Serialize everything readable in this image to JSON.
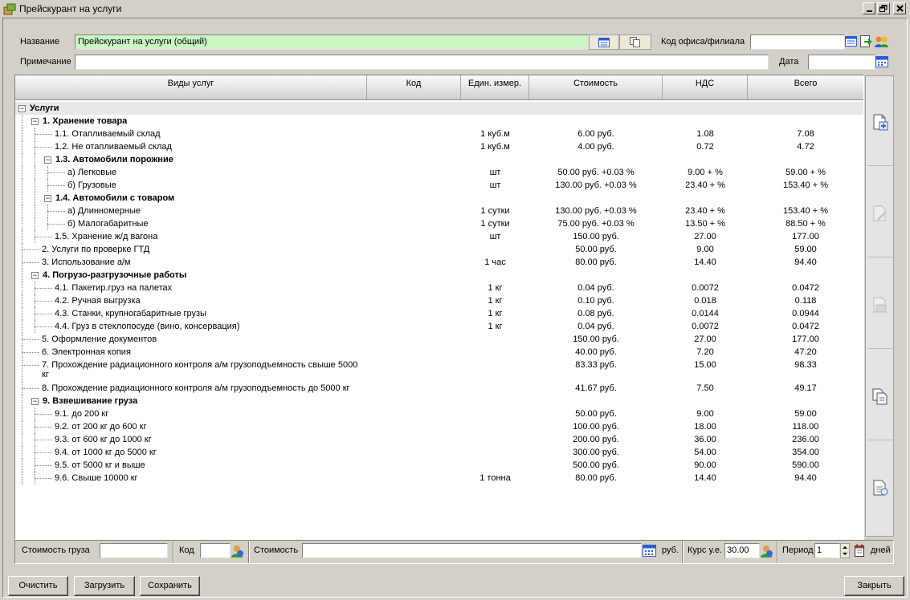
{
  "window": {
    "title": "Прейскурант на услуги"
  },
  "form": {
    "name_label": "Название",
    "name_value": "Прейскурант на услуги (общий)",
    "office_label": "Код офиса/филиала",
    "office_value": "",
    "note_label": "Примечание",
    "note_value": "",
    "date_label": "Дата",
    "date_value": ""
  },
  "table": {
    "columns": [
      "Виды услуг",
      "Код",
      "Един. измер.",
      "Стоимость",
      "НДС",
      "Всего"
    ],
    "rows": [
      {
        "name": "Услуги",
        "unit": "",
        "cost": "",
        "vat": "",
        "total": "",
        "level": 0,
        "bold": true,
        "expander": true,
        "selected": true
      },
      {
        "name": "1. Хранение товара",
        "unit": "",
        "cost": "",
        "vat": "",
        "total": "",
        "level": 1,
        "bold": true,
        "expander": true
      },
      {
        "name": "1.1. Отапливаемый склад",
        "unit": "1 куб.м",
        "cost": "6.00 руб.",
        "vat": "1.08",
        "total": "7.08",
        "level": 2
      },
      {
        "name": "1.2. Не отапливаемый склад",
        "unit": "1 куб.м",
        "cost": "4.00 руб.",
        "vat": "0.72",
        "total": "4.72",
        "level": 2
      },
      {
        "name": "1.3. Автомобили порожние",
        "unit": "",
        "cost": "",
        "vat": "",
        "total": "",
        "level": 2,
        "bold": true,
        "expander": true
      },
      {
        "name": "а) Легковые",
        "unit": "шт",
        "cost": "50.00 руб. +0.03 %",
        "vat": "9.00 + %",
        "total": "59.00 + %",
        "level": 3
      },
      {
        "name": "б) Грузовые",
        "unit": "шт",
        "cost": "130.00 руб. +0.03 %",
        "vat": "23.40 + %",
        "total": "153.40 + %",
        "level": 3
      },
      {
        "name": "1.4. Автомобили с товаром",
        "unit": "",
        "cost": "",
        "vat": "",
        "total": "",
        "level": 2,
        "bold": true,
        "expander": true
      },
      {
        "name": "а) Длинномерные",
        "unit": "1 сутки",
        "cost": "130.00 руб. +0.03 %",
        "vat": "23.40 + %",
        "total": "153.40 + %",
        "level": 3
      },
      {
        "name": "б) Малогабаритные",
        "unit": "1 сутки",
        "cost": "75.00 руб. +0.03 %",
        "vat": "13.50 + %",
        "total": "88.50 + %",
        "level": 3
      },
      {
        "name": "1.5. Хранение ж/д вагона",
        "unit": "шт",
        "cost": "150.00 руб.",
        "vat": "27.00",
        "total": "177.00",
        "level": 2
      },
      {
        "name": "2. Услуги по проверке ГТД",
        "unit": "",
        "cost": "50.00 руб.",
        "vat": "9.00",
        "total": "59.00",
        "level": 1
      },
      {
        "name": "3. Использование а/м",
        "unit": "1 час",
        "cost": "80.00 руб.",
        "vat": "14.40",
        "total": "94.40",
        "level": 1
      },
      {
        "name": "4. Погрузо-разгрузочные работы",
        "unit": "",
        "cost": "",
        "vat": "",
        "total": "",
        "level": 1,
        "bold": true,
        "expander": true
      },
      {
        "name": "4.1. Пакетир.груз на палетах",
        "unit": "1 кг",
        "cost": "0.04 руб.",
        "vat": "0.0072",
        "total": "0.0472",
        "level": 2
      },
      {
        "name": "4.2. Ручная выгрузка",
        "unit": "1 кг",
        "cost": "0.10 руб.",
        "vat": "0.018",
        "total": "0.118",
        "level": 2
      },
      {
        "name": "4.3. Станки, крупногабаритные грузы",
        "unit": "1 кг",
        "cost": "0.08 руб.",
        "vat": "0.0144",
        "total": "0.0944",
        "level": 2
      },
      {
        "name": "4.4. Груз в стеклопосуде (вино, консервация)",
        "unit": "1 кг",
        "cost": "0.04 руб.",
        "vat": "0.0072",
        "total": "0.0472",
        "level": 2
      },
      {
        "name": "5. Оформление документов",
        "unit": "",
        "cost": "150.00 руб.",
        "vat": "27.00",
        "total": "177.00",
        "level": 1
      },
      {
        "name": "6. Электронная копия",
        "unit": "",
        "cost": "40.00 руб.",
        "vat": "7.20",
        "total": "47.20",
        "level": 1
      },
      {
        "name": "7. Прохождение радиационного контроля а/м грузоподъемность свыше 5000",
        "name2": "кг",
        "unit": "",
        "cost": "83.33 руб.",
        "vat": "15.00",
        "total": "98.33",
        "level": 1,
        "tall": true
      },
      {
        "name": "8. Прохождение радиационного контроля а/м грузоподъемность до 5000 кг",
        "unit": "",
        "cost": "41.67 руб.",
        "vat": "7.50",
        "total": "49.17",
        "level": 1
      },
      {
        "name": "9. Взвешивание груза",
        "unit": "",
        "cost": "",
        "vat": "",
        "total": "",
        "level": 1,
        "bold": true,
        "expander": true
      },
      {
        "name": "9.1. до 200 кг",
        "unit": "",
        "cost": "50.00 руб.",
        "vat": "9.00",
        "total": "59.00",
        "level": 2
      },
      {
        "name": "9.2. от 200 кг до 600 кг",
        "unit": "",
        "cost": "100.00 руб.",
        "vat": "18.00",
        "total": "118.00",
        "level": 2
      },
      {
        "name": "9.3. от 600 кг до 1000 кг",
        "unit": "",
        "cost": "200.00 руб.",
        "vat": "36.00",
        "total": "236.00",
        "level": 2
      },
      {
        "name": "9.4. от 1000 кг до 5000 кг",
        "unit": "",
        "cost": "300.00 руб.",
        "vat": "54.00",
        "total": "354.00",
        "level": 2
      },
      {
        "name": "9.5. от 5000 кг и выше",
        "unit": "",
        "cost": "500.00 руб.",
        "vat": "90.00",
        "total": "590.00",
        "level": 2
      },
      {
        "name": "9.6. Свыше 10000 кг",
        "unit": "1 тонна",
        "cost": "80.00 руб.",
        "vat": "14.40",
        "total": "94.40",
        "level": 2
      }
    ]
  },
  "calc": {
    "cargo_cost_label": "Стоимость груза",
    "cargo_cost_value": "",
    "code_label": "Код",
    "code_value": "",
    "cost_label": "Стоимость",
    "cost_value": "",
    "currency": "руб.",
    "rate_label": "Курс у.е.",
    "rate_value": "30.00",
    "period_label": "Период",
    "period_value": "1",
    "days_label": "дней"
  },
  "buttons": {
    "clear": "Очистить",
    "load": "Загрузить",
    "save": "Сохранить",
    "close": "Закрыть"
  },
  "icons": [
    "app-icon",
    "minimize-icon",
    "restore-icon",
    "close-icon",
    "list-icon",
    "copy-icon",
    "export-icon",
    "users-icon",
    "calendar-icon",
    "add-doc-icon",
    "edit-doc-icon",
    "delete-doc-icon",
    "copy-doc-icon",
    "report-icon",
    "lookup-icon",
    "calculator-icon"
  ]
}
